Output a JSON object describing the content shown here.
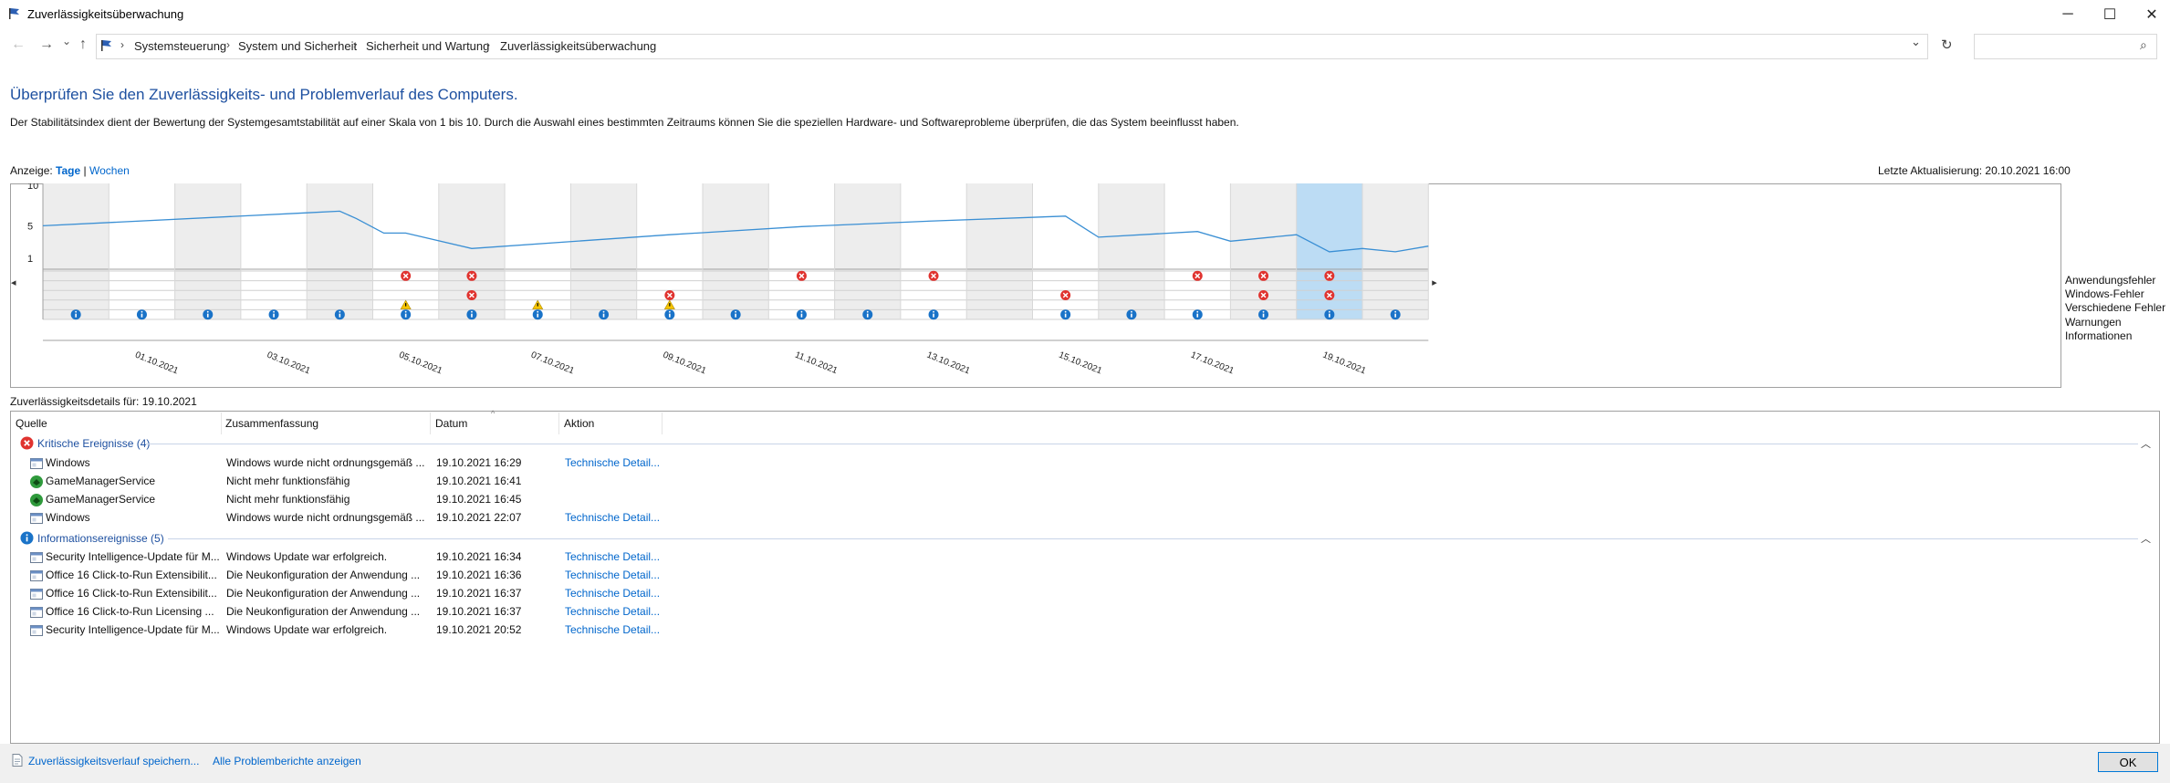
{
  "window": {
    "title": "Zuverlässigkeitsüberwachung",
    "minimize_icon": "─",
    "maximize_icon": "☐",
    "close_icon": "✕"
  },
  "nav": {
    "back_icon": "←",
    "forward_icon": "→",
    "recent_icon": "⌄",
    "up_icon": "↑",
    "breadcrumbs": [
      "Systemsteuerung",
      "System und Sicherheit",
      "Sicherheit und Wartung",
      "Zuverlässigkeitsüberwachung"
    ],
    "separator": "›",
    "dropdown_icon": "⌄",
    "refresh_icon": "↻",
    "search_icon": "⌕"
  },
  "main": {
    "heading": "Überprüfen Sie den Zuverlässigkeits- und Problemverlauf des Computers.",
    "description": "Der Stabilitätsindex dient der Bewertung der Systemgesamtstabilität auf einer Skala von 1 bis 10. Durch die Auswahl eines bestimmten Zeitraums können Sie die speziellen Hardware- und Softwareprobleme überprüfen, die das System beeinflusst haben.",
    "view_label": "Anzeige:",
    "view_days": "Tage",
    "view_sep": "|",
    "view_weeks": "Wochen",
    "last_update": "Letzte Aktualisierung: 20.10.2021 16:00",
    "scroll_left": "◂",
    "scroll_right": "▸"
  },
  "chart_data": {
    "type": "line",
    "y_ticks": [
      "10",
      "5",
      "1"
    ],
    "ylim": [
      1,
      10
    ],
    "date_labels": [
      "01.10.2021",
      "03.10.2021",
      "05.10.2021",
      "07.10.2021",
      "09.10.2021",
      "11.10.2021",
      "13.10.2021",
      "15.10.2021",
      "17.10.2021",
      "19.10.2021"
    ],
    "days": [
      "30.09.2021",
      "01.10.2021",
      "02.10.2021",
      "03.10.2021",
      "04.10.2021",
      "05.10.2021",
      "06.10.2021",
      "07.10.2021",
      "08.10.2021",
      "09.10.2021",
      "10.10.2021",
      "11.10.2021",
      "12.10.2021",
      "13.10.2021",
      "14.10.2021",
      "15.10.2021",
      "16.10.2021",
      "17.10.2021",
      "18.10.2021",
      "19.10.2021",
      "20.10.2021"
    ],
    "stability_index": [
      {
        "x": "30.09.2021 00:00",
        "y": 5.0
      },
      {
        "x": "04.10.2021 00:00",
        "y": 6.6
      },
      {
        "x": "04.10.2021 12:00",
        "y": 6.8
      },
      {
        "x": "04.10.2021 18:00",
        "y": 5.9
      },
      {
        "x": "05.10.2021 04:00",
        "y": 4.1
      },
      {
        "x": "05.10.2021 12:00",
        "y": 4.1
      },
      {
        "x": "06.10.2021 12:00",
        "y": 2.2
      },
      {
        "x": "09.10.2021 12:00",
        "y": 3.9
      },
      {
        "x": "11.10.2021 12:00",
        "y": 4.9
      },
      {
        "x": "13.10.2021 12:00",
        "y": 5.6
      },
      {
        "x": "15.10.2021 12:00",
        "y": 6.2
      },
      {
        "x": "16.10.2021 00:00",
        "y": 3.6
      },
      {
        "x": "17.10.2021 12:00",
        "y": 4.3
      },
      {
        "x": "18.10.2021 00:00",
        "y": 3.1
      },
      {
        "x": "19.10.2021 00:00",
        "y": 3.9
      },
      {
        "x": "19.10.2021 12:00",
        "y": 1.8
      },
      {
        "x": "20.10.2021 00:00",
        "y": 2.2
      },
      {
        "x": "20.10.2021 12:00",
        "y": 1.8
      },
      {
        "x": "21.10.2021 00:00",
        "y": 2.5
      }
    ],
    "event_rows": [
      "Anwendungsfehler",
      "Windows-Fehler",
      "Verschiedene Fehler",
      "Warnungen",
      "Informationen"
    ],
    "events": [
      {
        "row": "Anwendungsfehler",
        "day": "05.10.2021",
        "type": "error"
      },
      {
        "row": "Anwendungsfehler",
        "day": "06.10.2021",
        "type": "error"
      },
      {
        "row": "Anwendungsfehler",
        "day": "11.10.2021",
        "type": "error"
      },
      {
        "row": "Anwendungsfehler",
        "day": "13.10.2021",
        "type": "error"
      },
      {
        "row": "Anwendungsfehler",
        "day": "17.10.2021",
        "type": "error"
      },
      {
        "row": "Anwendungsfehler",
        "day": "18.10.2021",
        "type": "error"
      },
      {
        "row": "Anwendungsfehler",
        "day": "19.10.2021",
        "type": "error"
      },
      {
        "row": "Verschiedene Fehler",
        "day": "06.10.2021",
        "type": "error"
      },
      {
        "row": "Verschiedene Fehler",
        "day": "09.10.2021",
        "type": "error"
      },
      {
        "row": "Verschiedene Fehler",
        "day": "15.10.2021",
        "type": "error"
      },
      {
        "row": "Verschiedene Fehler",
        "day": "18.10.2021",
        "type": "error"
      },
      {
        "row": "Verschiedene Fehler",
        "day": "19.10.2021",
        "type": "error"
      },
      {
        "row": "Warnungen",
        "day": "05.10.2021",
        "type": "warning"
      },
      {
        "row": "Warnungen",
        "day": "07.10.2021",
        "type": "warning"
      },
      {
        "row": "Warnungen",
        "day": "09.10.2021",
        "type": "warning"
      },
      {
        "row": "Informationen",
        "day": "30.09.2021",
        "type": "info"
      },
      {
        "row": "Informationen",
        "day": "01.10.2021",
        "type": "info"
      },
      {
        "row": "Informationen",
        "day": "02.10.2021",
        "type": "info"
      },
      {
        "row": "Informationen",
        "day": "03.10.2021",
        "type": "info"
      },
      {
        "row": "Informationen",
        "day": "04.10.2021",
        "type": "info"
      },
      {
        "row": "Informationen",
        "day": "05.10.2021",
        "type": "info"
      },
      {
        "row": "Informationen",
        "day": "06.10.2021",
        "type": "info"
      },
      {
        "row": "Informationen",
        "day": "07.10.2021",
        "type": "info"
      },
      {
        "row": "Informationen",
        "day": "08.10.2021",
        "type": "info"
      },
      {
        "row": "Informationen",
        "day": "09.10.2021",
        "type": "info"
      },
      {
        "row": "Informationen",
        "day": "10.10.2021",
        "type": "info"
      },
      {
        "row": "Informationen",
        "day": "11.10.2021",
        "type": "info"
      },
      {
        "row": "Informationen",
        "day": "12.10.2021",
        "type": "info"
      },
      {
        "row": "Informationen",
        "day": "13.10.2021",
        "type": "info"
      },
      {
        "row": "Informationen",
        "day": "15.10.2021",
        "type": "info"
      },
      {
        "row": "Informationen",
        "day": "16.10.2021",
        "type": "info"
      },
      {
        "row": "Informationen",
        "day": "17.10.2021",
        "type": "info"
      },
      {
        "row": "Informationen",
        "day": "18.10.2021",
        "type": "info"
      },
      {
        "row": "Informationen",
        "day": "19.10.2021",
        "type": "info"
      },
      {
        "row": "Informationen",
        "day": "20.10.2021",
        "type": "info"
      }
    ],
    "selected_day": "19.10.2021",
    "grid": true,
    "legend_position": "right"
  },
  "details": {
    "label": "Zuverlässigkeitsdetails für: 19.10.2021",
    "columns": [
      "Quelle",
      "Zusammenfassung",
      "Datum",
      "Aktion"
    ],
    "sort_indicator": "^",
    "groups": [
      {
        "title": "Kritische Ereignisse (4)",
        "icon": "error-icon",
        "rows": [
          {
            "icon": "window-icon",
            "source": "Windows",
            "summary": "Windows wurde nicht ordnungsgemäß ...",
            "date": "19.10.2021 16:29",
            "action": "Technische Detail..."
          },
          {
            "icon": "game-icon",
            "source": "GameManagerService",
            "summary": "Nicht mehr funktionsfähig",
            "date": "19.10.2021 16:41",
            "action": ""
          },
          {
            "icon": "game-icon",
            "source": "GameManagerService",
            "summary": "Nicht mehr funktionsfähig",
            "date": "19.10.2021 16:45",
            "action": ""
          },
          {
            "icon": "window-icon",
            "source": "Windows",
            "summary": "Windows wurde nicht ordnungsgemäß ...",
            "date": "19.10.2021 22:07",
            "action": "Technische Detail..."
          }
        ]
      },
      {
        "title": "Informationsereignisse (5)",
        "icon": "info-icon",
        "rows": [
          {
            "icon": "window-icon",
            "source": "Security Intelligence-Update für M...",
            "summary": "Windows Update war erfolgreich.",
            "date": "19.10.2021 16:34",
            "action": "Technische Detail..."
          },
          {
            "icon": "window-icon",
            "source": "Office 16 Click-to-Run Extensibilit...",
            "summary": "Die Neukonfiguration der Anwendung ...",
            "date": "19.10.2021 16:36",
            "action": "Technische Detail..."
          },
          {
            "icon": "window-icon",
            "source": "Office 16 Click-to-Run Extensibilit...",
            "summary": "Die Neukonfiguration der Anwendung ...",
            "date": "19.10.2021 16:37",
            "action": "Technische Detail..."
          },
          {
            "icon": "window-icon",
            "source": "Office 16 Click-to-Run Licensing ...",
            "summary": "Die Neukonfiguration der Anwendung ...",
            "date": "19.10.2021 16:37",
            "action": "Technische Detail..."
          },
          {
            "icon": "window-icon",
            "source": "Security Intelligence-Update für M...",
            "summary": "Windows Update war erfolgreich.",
            "date": "19.10.2021 20:52",
            "action": "Technische Detail..."
          }
        ]
      }
    ],
    "collapse_icon": "︿"
  },
  "footer": {
    "save_link": "Zuverlässigkeitsverlauf speichern...",
    "reports_link": "Alle Problemberichte anzeigen",
    "ok_label": "OK"
  },
  "colors": {
    "line": "#3a8fd4",
    "selected": "#bcdcf4",
    "alt_band": "#ededed",
    "error": "#e0332f",
    "warning": "#f5c400",
    "info": "#1a73c8",
    "link": "#0066cc",
    "heading": "#1e50a0"
  }
}
